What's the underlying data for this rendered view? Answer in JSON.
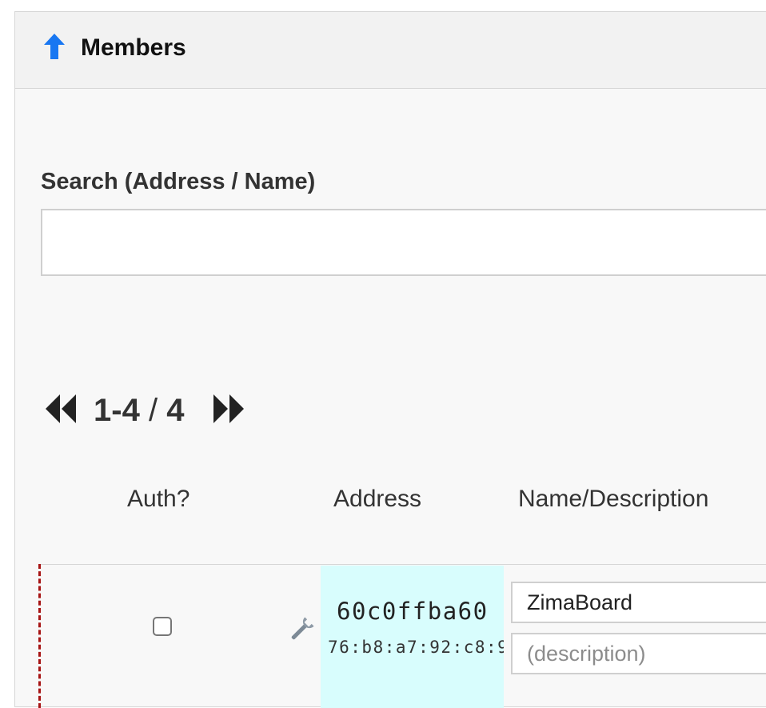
{
  "header": {
    "title": "Members",
    "icon": "arrow-up-icon",
    "icon_color": "#1877f2"
  },
  "search": {
    "label": "Search (Address / Name)",
    "value": "",
    "placeholder": ""
  },
  "pager": {
    "range": "1-4",
    "separator": "/",
    "total": "4",
    "first_icon": "double-chevron-left-icon",
    "last_icon": "double-chevron-right-icon"
  },
  "table": {
    "columns": [
      "Auth?",
      "Address",
      "Name/Description"
    ],
    "rows": [
      {
        "authorized": false,
        "settings_icon": "wrench-icon",
        "address": "60c0ffba60",
        "mac": "76:b8:a7:92:c8:9",
        "name": "ZimaBoard",
        "description": "",
        "description_placeholder": "(description)",
        "address_bg": "#d8fdfd",
        "marker_color": "#a61414"
      }
    ]
  }
}
